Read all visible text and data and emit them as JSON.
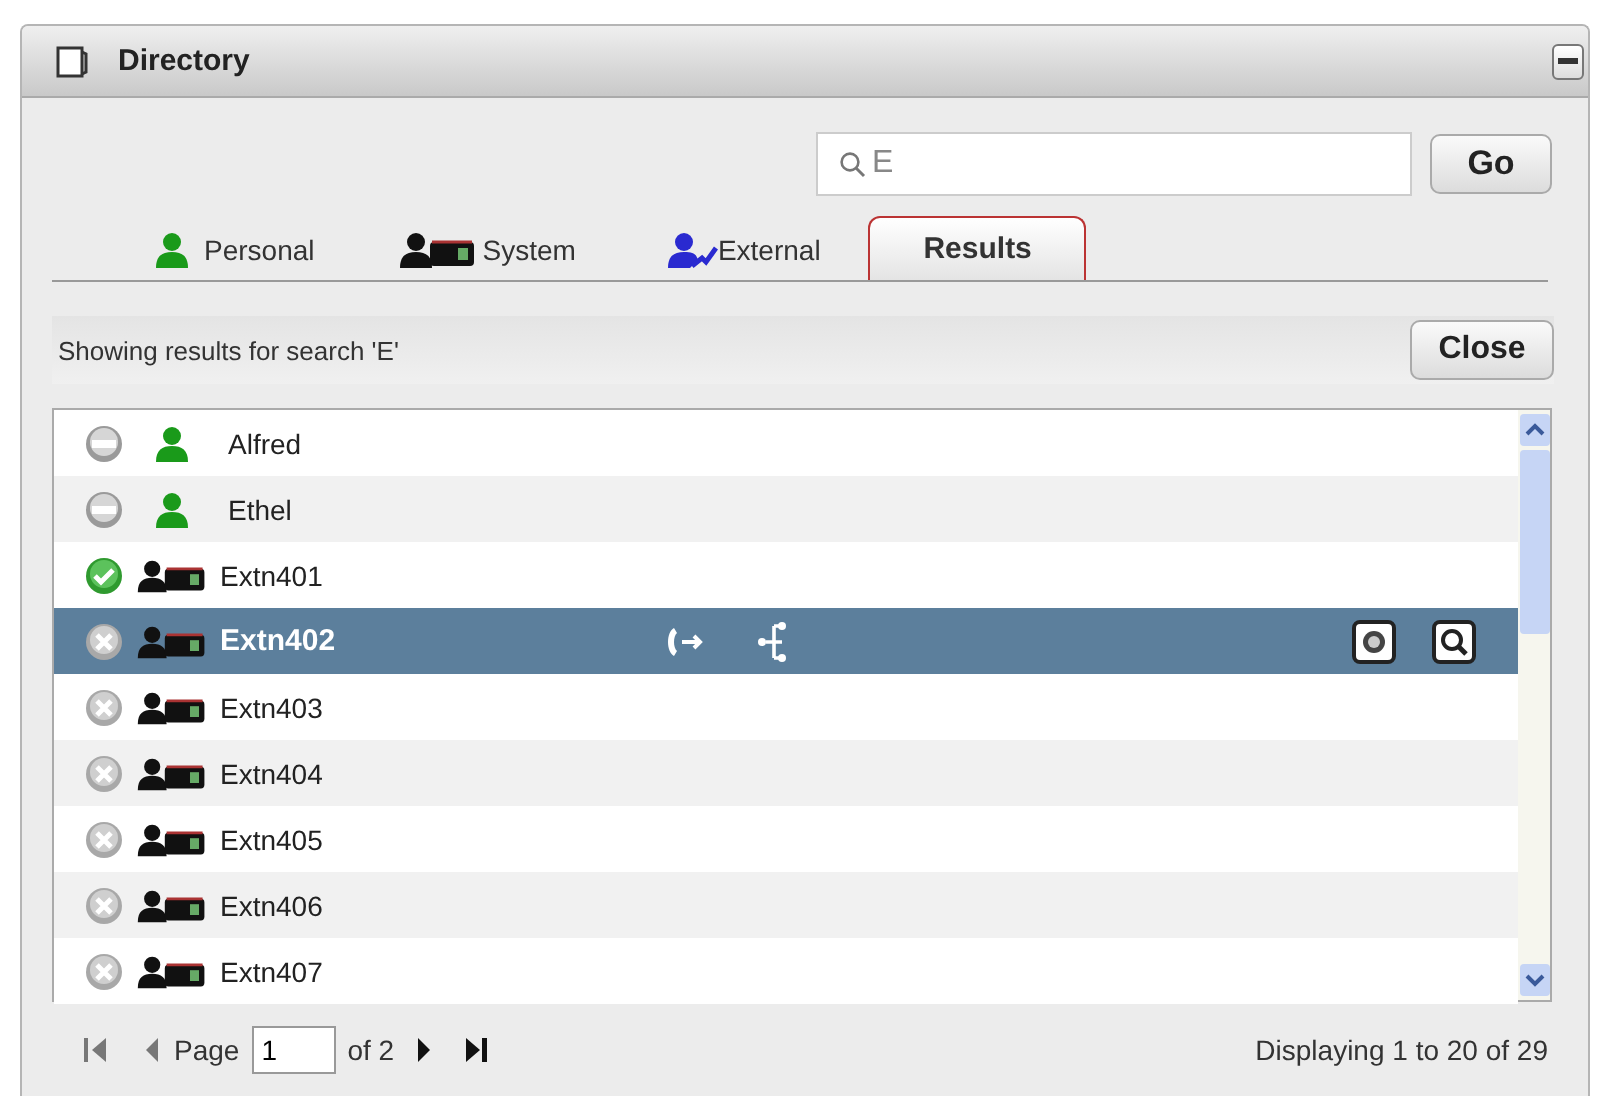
{
  "window": {
    "title": "Directory"
  },
  "search": {
    "value": "E"
  },
  "go_button": "Go",
  "tabs": [
    {
      "label": "Personal",
      "kind": "personal",
      "selected": false
    },
    {
      "label": "System",
      "kind": "system",
      "selected": false
    },
    {
      "label": "External",
      "kind": "external",
      "selected": false
    },
    {
      "label": "Results",
      "kind": "plain",
      "selected": true
    }
  ],
  "results_bar": {
    "text": "Showing results for search 'E'",
    "close_button": "Close"
  },
  "rows": [
    {
      "name": "Alfred",
      "presence": {
        "kind": "unknown"
      },
      "kind": "personal",
      "selected": false
    },
    {
      "name": "Ethel",
      "presence": {
        "kind": "unknown"
      },
      "kind": "personal",
      "selected": false
    },
    {
      "name": "Extn401",
      "presence": {
        "kind": "available"
      },
      "kind": "system",
      "selected": false
    },
    {
      "name": "Extn402",
      "presence": {
        "kind": "offline"
      },
      "kind": "system",
      "selected": true
    },
    {
      "name": "Extn403",
      "presence": {
        "kind": "offline"
      },
      "kind": "system",
      "selected": false
    },
    {
      "name": "Extn404",
      "presence": {
        "kind": "offline"
      },
      "kind": "system",
      "selected": false
    },
    {
      "name": "Extn405",
      "presence": {
        "kind": "offline"
      },
      "kind": "system",
      "selected": false
    },
    {
      "name": "Extn406",
      "presence": {
        "kind": "offline"
      },
      "kind": "system",
      "selected": false
    },
    {
      "name": "Extn407",
      "presence": {
        "kind": "offline"
      },
      "kind": "system",
      "selected": false
    }
  ],
  "pager": {
    "page_label": "Page",
    "page": "1",
    "of_label": "of 2",
    "summary": "Displaying 1 to 20 of 29"
  }
}
